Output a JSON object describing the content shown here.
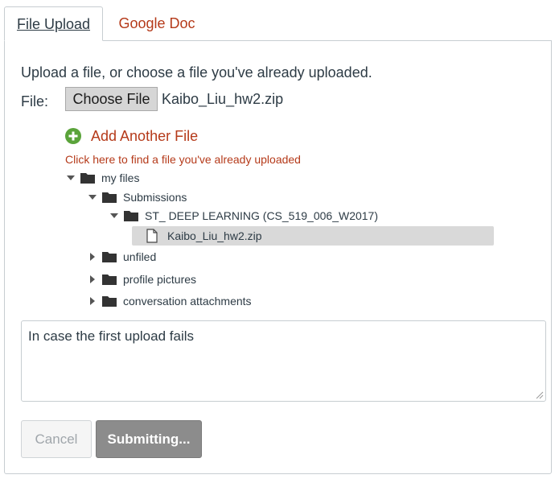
{
  "tabs": [
    {
      "label": "File Upload",
      "active": true
    },
    {
      "label": "Google Doc",
      "active": false
    }
  ],
  "upload": {
    "intro": "Upload a file, or choose a file you've already uploaded.",
    "file_label": "File:",
    "choose_button": "Choose File",
    "file_name": "Kaibo_Liu_hw2.zip",
    "add_another": "Add Another File",
    "find_link": "Click here to find a file you've already uploaded"
  },
  "tree": {
    "my_files": "my files",
    "submissions": "Submissions",
    "course_folder": "ST_ DEEP LEARNING (CS_519_006_W2017)",
    "selected_file": "Kaibo_Liu_hw2.zip",
    "unfiled": "unfiled",
    "profile_pictures": "profile pictures",
    "conversation_attachments": "conversation attachments"
  },
  "comment": {
    "value": "In case the first upload fails"
  },
  "actions": {
    "cancel": "Cancel",
    "submit": "Submitting..."
  },
  "colors": {
    "link": "#b53a1a",
    "add_icon": "#5aa33a",
    "selected_bg": "#d9d9d9",
    "submit_bg": "#8c8c8c"
  },
  "icons": {
    "add": "plus-circle-icon",
    "folder": "folder-icon",
    "file": "document-icon",
    "expanded": "triangle-down-icon",
    "collapsed": "triangle-right-icon"
  }
}
